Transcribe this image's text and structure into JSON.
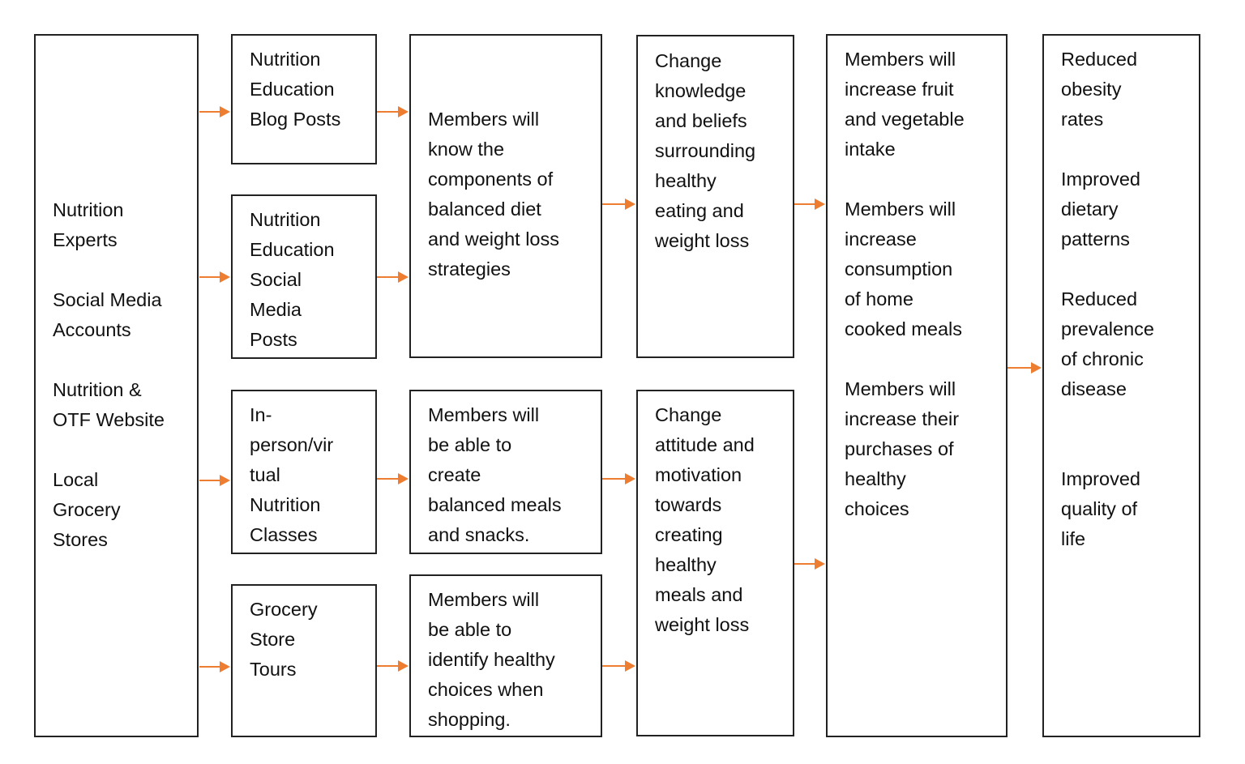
{
  "colors": {
    "arrow": "#ED7D31",
    "border": "#222222"
  },
  "boxes": [
    {
      "id": "inputs",
      "lines": [
        "Nutrition",
        "Experts",
        "",
        "Social Media",
        "Accounts",
        "",
        "Nutrition &",
        "OTF Website",
        "",
        "Local",
        "Grocery",
        "Stores"
      ]
    },
    {
      "id": "blog-posts",
      "lines": [
        "Nutrition",
        "Education",
        "Blog Posts"
      ]
    },
    {
      "id": "social-posts",
      "lines": [
        "Nutrition",
        "Education",
        "Social",
        "Media",
        "Posts"
      ]
    },
    {
      "id": "classes",
      "lines": [
        "In-",
        "person/vir",
        "tual",
        "Nutrition",
        "Classes"
      ]
    },
    {
      "id": "grocery-tours",
      "lines": [
        "Grocery",
        "Store",
        "Tours"
      ]
    },
    {
      "id": "know-components",
      "lines": [
        "Members will",
        "know the",
        "components of",
        "balanced diet",
        "and weight loss",
        "strategies"
      ]
    },
    {
      "id": "create-meals",
      "lines": [
        "Members will",
        "be able to",
        "create",
        "balanced meals",
        "and snacks."
      ]
    },
    {
      "id": "identify-choices",
      "lines": [
        "Members will",
        "be able to",
        "identify healthy",
        "choices when",
        "shopping."
      ]
    },
    {
      "id": "change-knowledge",
      "lines": [
        "Change",
        "knowledge",
        "and beliefs",
        "surrounding",
        "healthy",
        "eating and",
        "weight loss"
      ]
    },
    {
      "id": "change-attitude",
      "lines": [
        "Change",
        "attitude and",
        "motivation",
        "towards",
        "creating",
        "healthy",
        "meals and",
        "weight loss"
      ]
    },
    {
      "id": "behaviors",
      "lines": [
        "Members will",
        "increase fruit",
        "and vegetable",
        "intake",
        "",
        "Members will",
        "increase",
        "consumption",
        "of home",
        "cooked meals",
        "",
        "Members will",
        "increase their",
        "purchases of",
        "healthy",
        "choices"
      ]
    },
    {
      "id": "impacts",
      "lines": [
        "Reduced",
        "obesity",
        "rates",
        "",
        "Improved",
        "dietary",
        "patterns",
        "",
        "Reduced",
        "prevalence",
        "of chronic",
        "disease",
        "",
        "",
        "Improved",
        "quality of",
        "life"
      ]
    }
  ]
}
